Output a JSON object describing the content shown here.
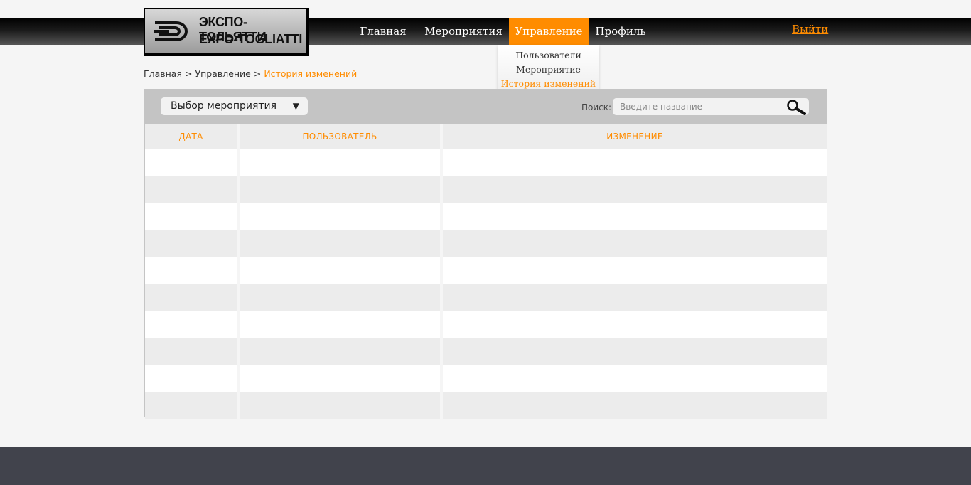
{
  "logo": {
    "text_ru": "ЭКСПО-ТОЛЬЯТТИ",
    "text_en": "EXPO-TOGLIATTI"
  },
  "nav": {
    "items": [
      {
        "label": "Главная",
        "active": false
      },
      {
        "label": "Мероприятия",
        "active": false
      },
      {
        "label": "Управление",
        "active": true
      },
      {
        "label": "Профиль",
        "active": false
      }
    ],
    "logout": "Выйти",
    "dropdown": [
      {
        "label": "Пользователи",
        "active": false
      },
      {
        "label": "Мероприятие",
        "active": false
      },
      {
        "label": "История изменений",
        "active": true
      }
    ]
  },
  "breadcrumb": {
    "items": [
      "Главная",
      "Управление"
    ],
    "separator": ">",
    "current": "История изменений"
  },
  "toolbar": {
    "select_label": "Выбор мероприятия",
    "select_arrow": "▼",
    "search_label": "Поиск:",
    "search_placeholder": "Введите название"
  },
  "table": {
    "columns": [
      "ДАТА",
      "ПОЛЬЗОВАТЕЛЬ",
      "ИЗМЕНЕНИЕ"
    ]
  },
  "colors": {
    "accent": "#ff8c00",
    "panel": "#c4c4c4",
    "footer": "#41434c"
  }
}
